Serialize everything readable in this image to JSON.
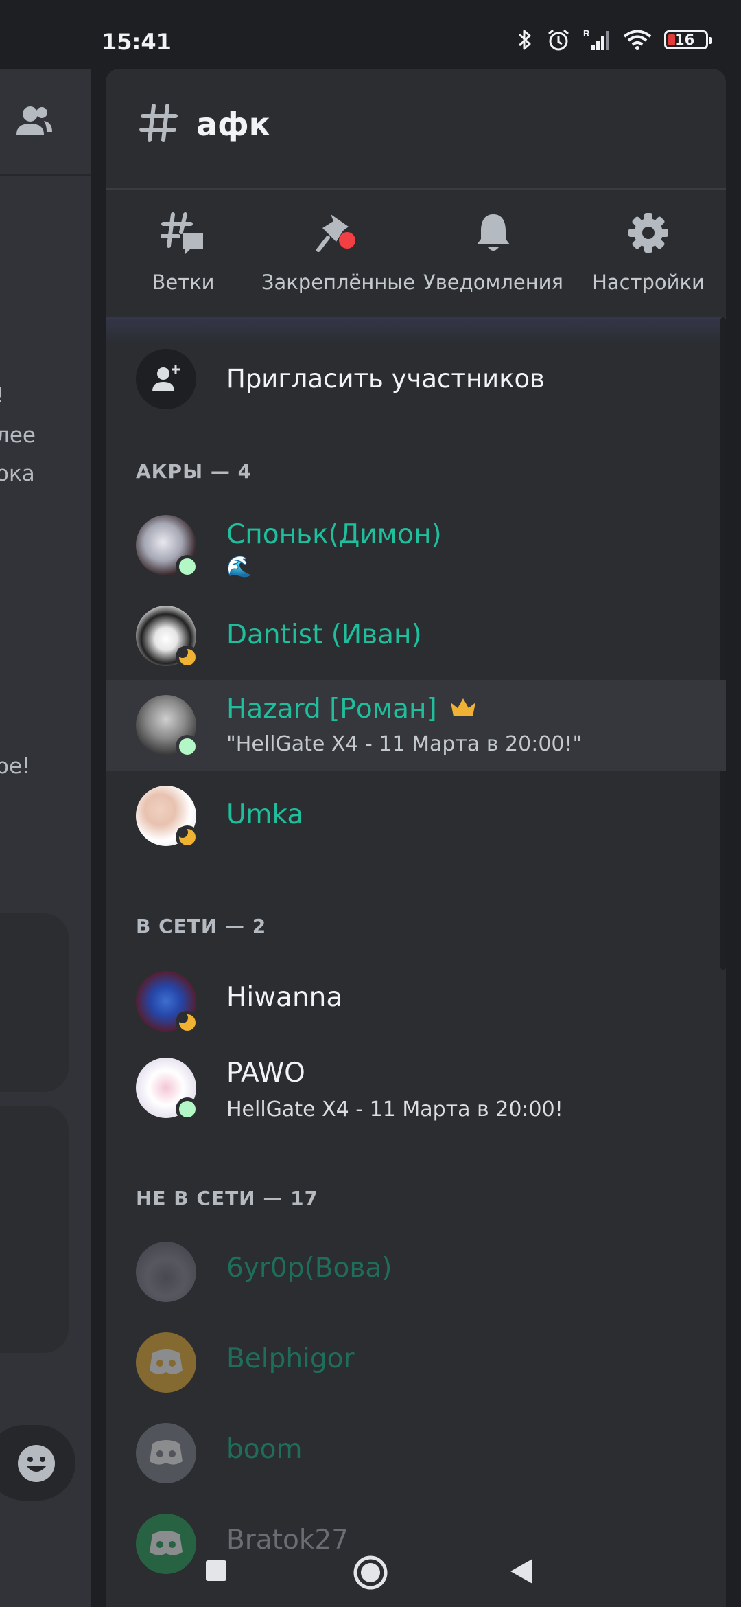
{
  "status_bar": {
    "time": "15:41",
    "battery_level": "16",
    "icons": [
      "bluetooth-icon",
      "alarm-icon",
      "signal-icon",
      "wifi-icon",
      "battery-icon"
    ]
  },
  "background_chat": {
    "fragments": [
      "!",
      "лее",
      "ока",
      "ое!"
    ]
  },
  "channel": {
    "name": "афк"
  },
  "actions": [
    {
      "label": "Ветки",
      "icon": "threads-icon"
    },
    {
      "label": "Закреплённые",
      "icon": "pin-icon"
    },
    {
      "label": "Уведомления",
      "icon": "bell-icon"
    },
    {
      "label": "Настройки",
      "icon": "gear-icon"
    }
  ],
  "invite": {
    "label": "Пригласить участников"
  },
  "sections": [
    {
      "title": "АКРЫ — 4"
    },
    {
      "title": "В СЕТИ — 2"
    },
    {
      "title": "НЕ В СЕТИ — 17"
    }
  ],
  "members": [
    {
      "name": "Споньк(Димон)",
      "sub": "🌊",
      "status": "online",
      "color": "#1fbf9d"
    },
    {
      "name": "Dantist (Иван)",
      "sub": "",
      "status": "idle",
      "color": "#1fbf9d"
    },
    {
      "name": "Hazard [Роман]",
      "sub": "\"HellGate X4 - 11 Марта в 20:00!\"",
      "status": "online",
      "color": "#1fbf9d",
      "badge": "crown-icon"
    },
    {
      "name": "Umka",
      "sub": "",
      "status": "idle",
      "color": "#1fbf9d"
    },
    {
      "name": "Hiwanna",
      "sub": "",
      "status": "idle",
      "color": "#f2f3f5"
    },
    {
      "name": "PAWO",
      "sub": "HellGate X4 - 11 Марта в 20:00!",
      "status": "online",
      "color": "#f2f3f5"
    },
    {
      "name": "6yr0p(Вова)",
      "status": "offline"
    },
    {
      "name": "Belphigor",
      "status": "offline"
    },
    {
      "name": "boom",
      "status": "offline"
    },
    {
      "name": "Bratok27",
      "status": "offline"
    }
  ]
}
